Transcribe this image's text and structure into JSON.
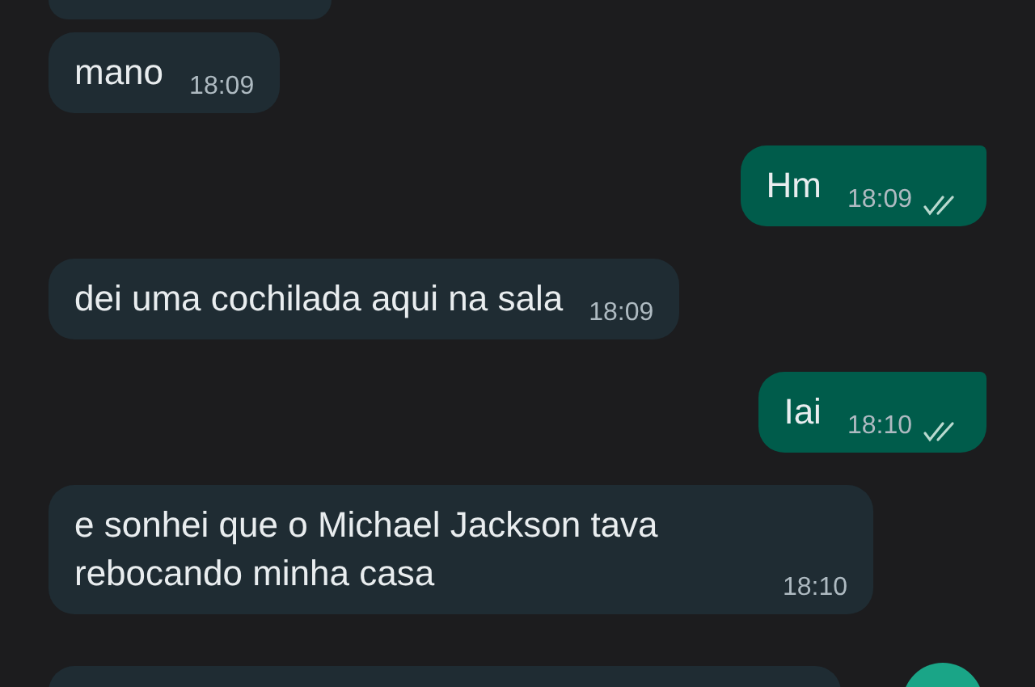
{
  "messages": [
    {
      "kind": "incoming",
      "text": "mano",
      "time": "18:09"
    },
    {
      "kind": "outgoing",
      "text": "Hm",
      "time": "18:09",
      "read": false
    },
    {
      "kind": "incoming",
      "text": "dei uma cochilada aqui na sala",
      "time": "18:09"
    },
    {
      "kind": "outgoing",
      "text": "Iai",
      "time": "18:10",
      "read": false
    },
    {
      "kind": "incoming",
      "text": "e sonhei que o Michael Jackson tava rebocando minha casa",
      "time": "18:10"
    }
  ]
}
